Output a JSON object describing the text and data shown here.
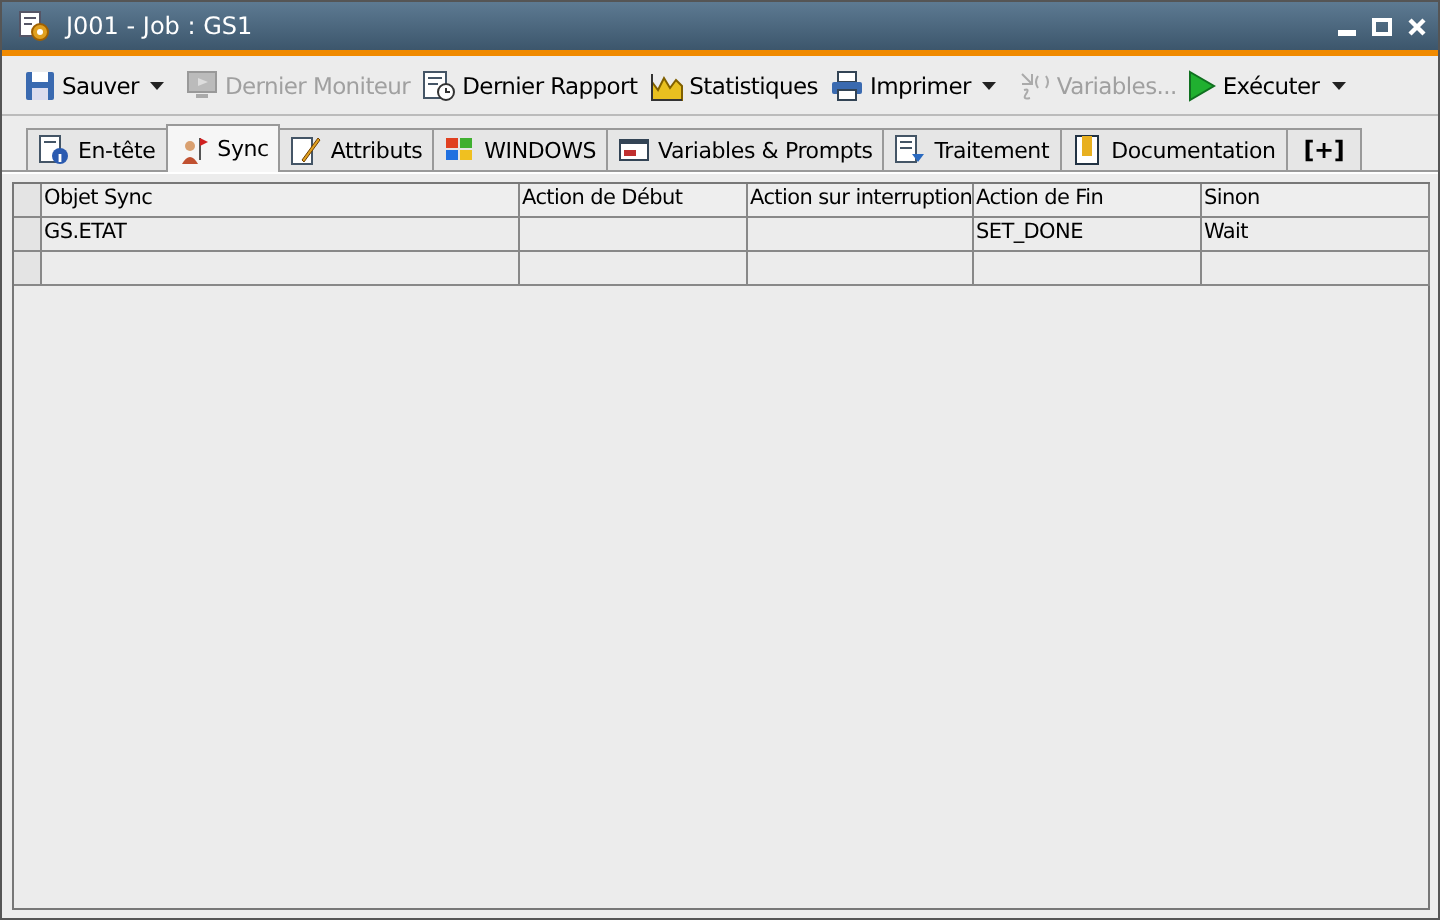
{
  "window": {
    "title": "J001 - Job : GS1"
  },
  "toolbar": [
    {
      "label": "Sauver",
      "kind": "save",
      "disabled": false,
      "dropdown": true
    },
    {
      "label": "Dernier Moniteur",
      "kind": "monitor",
      "disabled": true,
      "dropdown": false
    },
    {
      "label": "Dernier Rapport",
      "kind": "report",
      "disabled": false,
      "dropdown": false
    },
    {
      "label": "Statistiques",
      "kind": "stats",
      "disabled": false,
      "dropdown": false
    },
    {
      "label": "Imprimer",
      "kind": "print",
      "disabled": false,
      "dropdown": true
    },
    {
      "label": "Variables...",
      "kind": "variables",
      "disabled": true,
      "dropdown": false
    },
    {
      "label": "Exécuter",
      "kind": "run",
      "disabled": false,
      "dropdown": true
    }
  ],
  "tabs": [
    {
      "label": "En-tête",
      "kind": "info",
      "selected": false
    },
    {
      "label": "Sync",
      "kind": "sync",
      "selected": true
    },
    {
      "label": "Attributs",
      "kind": "attr",
      "selected": false
    },
    {
      "label": "WINDOWS",
      "kind": "windows",
      "selected": false
    },
    {
      "label": "Variables & Prompts",
      "kind": "vars",
      "selected": false
    },
    {
      "label": "Traitement",
      "kind": "process",
      "selected": false
    },
    {
      "label": "Documentation",
      "kind": "doc",
      "selected": false
    },
    {
      "label": "[+]",
      "kind": "add",
      "selected": false
    }
  ],
  "table": {
    "columns": [
      "Objet Sync",
      "Action de Début",
      "Action sur interruption",
      "Action de Fin",
      "Sinon"
    ],
    "rows": [
      [
        "GS.ETAT",
        "",
        "",
        "SET_DONE",
        "Wait"
      ],
      [
        "",
        "",
        "",
        "",
        ""
      ]
    ]
  }
}
